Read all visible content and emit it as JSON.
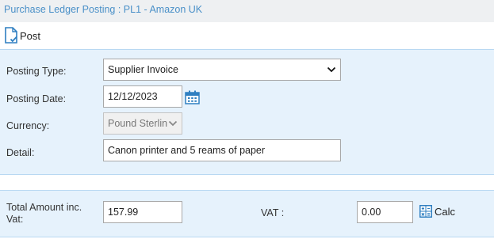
{
  "window": {
    "title": "Purchase Ledger Posting : PL1 - Amazon UK"
  },
  "toolbar": {
    "post_label": "Post"
  },
  "form": {
    "posting_type": {
      "label": "Posting Type:",
      "value": "Supplier Invoice"
    },
    "posting_date": {
      "label": "Posting Date:",
      "value": "12/12/2023"
    },
    "currency": {
      "label": "Currency:",
      "value": "Pound Sterlin"
    },
    "detail": {
      "label": "Detail:",
      "value": "Canon printer and 5 reams of paper"
    }
  },
  "totals": {
    "total_amount": {
      "label_line1": "Total Amount inc.",
      "label_line2": "Vat:",
      "value": "157.99"
    },
    "vat": {
      "label": "VAT :",
      "value": "0.00"
    },
    "calc_label": "Calc"
  },
  "colors": {
    "title_text": "#4a90c8",
    "panel_bg": "#e6f2fc",
    "panel_border": "#b8d8f2",
    "icon_blue": "#2f7fc1"
  }
}
